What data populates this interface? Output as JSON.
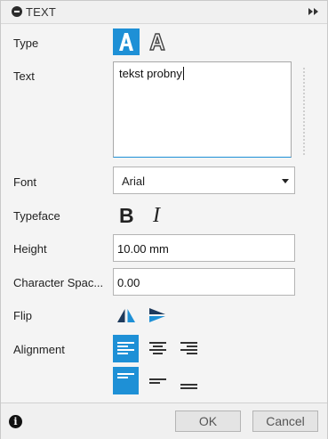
{
  "panel": {
    "title": "TEXT",
    "collapse_icon": "minus-circle-icon",
    "expand_icon": "double-chevron-right-icon"
  },
  "fields": {
    "type_label": "Type",
    "text_label": "Text",
    "text_value": "tekst probny",
    "font_label": "Font",
    "font_value": "Arial",
    "typeface_label": "Typeface",
    "height_label": "Height",
    "height_value": "10.00 mm",
    "char_spacing_label": "Character Spac...",
    "char_spacing_value": "0.00",
    "flip_label": "Flip",
    "alignment_label": "Alignment"
  },
  "type_options": [
    {
      "name": "filled-text-icon",
      "selected": true
    },
    {
      "name": "outline-text-icon",
      "selected": false
    }
  ],
  "typeface_buttons": [
    {
      "name": "bold-icon",
      "glyph": "B"
    },
    {
      "name": "italic-icon",
      "glyph": "I"
    }
  ],
  "flip_buttons": [
    "flip-horizontal-icon",
    "flip-vertical-icon"
  ],
  "h_align": [
    {
      "name": "align-left-icon",
      "selected": true
    },
    {
      "name": "align-center-icon",
      "selected": false
    },
    {
      "name": "align-right-icon",
      "selected": false
    }
  ],
  "v_align": [
    {
      "name": "align-top-icon",
      "selected": true
    },
    {
      "name": "align-middle-icon",
      "selected": false
    },
    {
      "name": "align-bottom-icon",
      "selected": false
    }
  ],
  "footer": {
    "info_icon": "info-icon",
    "ok_label": "OK",
    "cancel_label": "Cancel"
  },
  "colors": {
    "accent": "#1e90d6",
    "background": "#f4f4f4"
  }
}
